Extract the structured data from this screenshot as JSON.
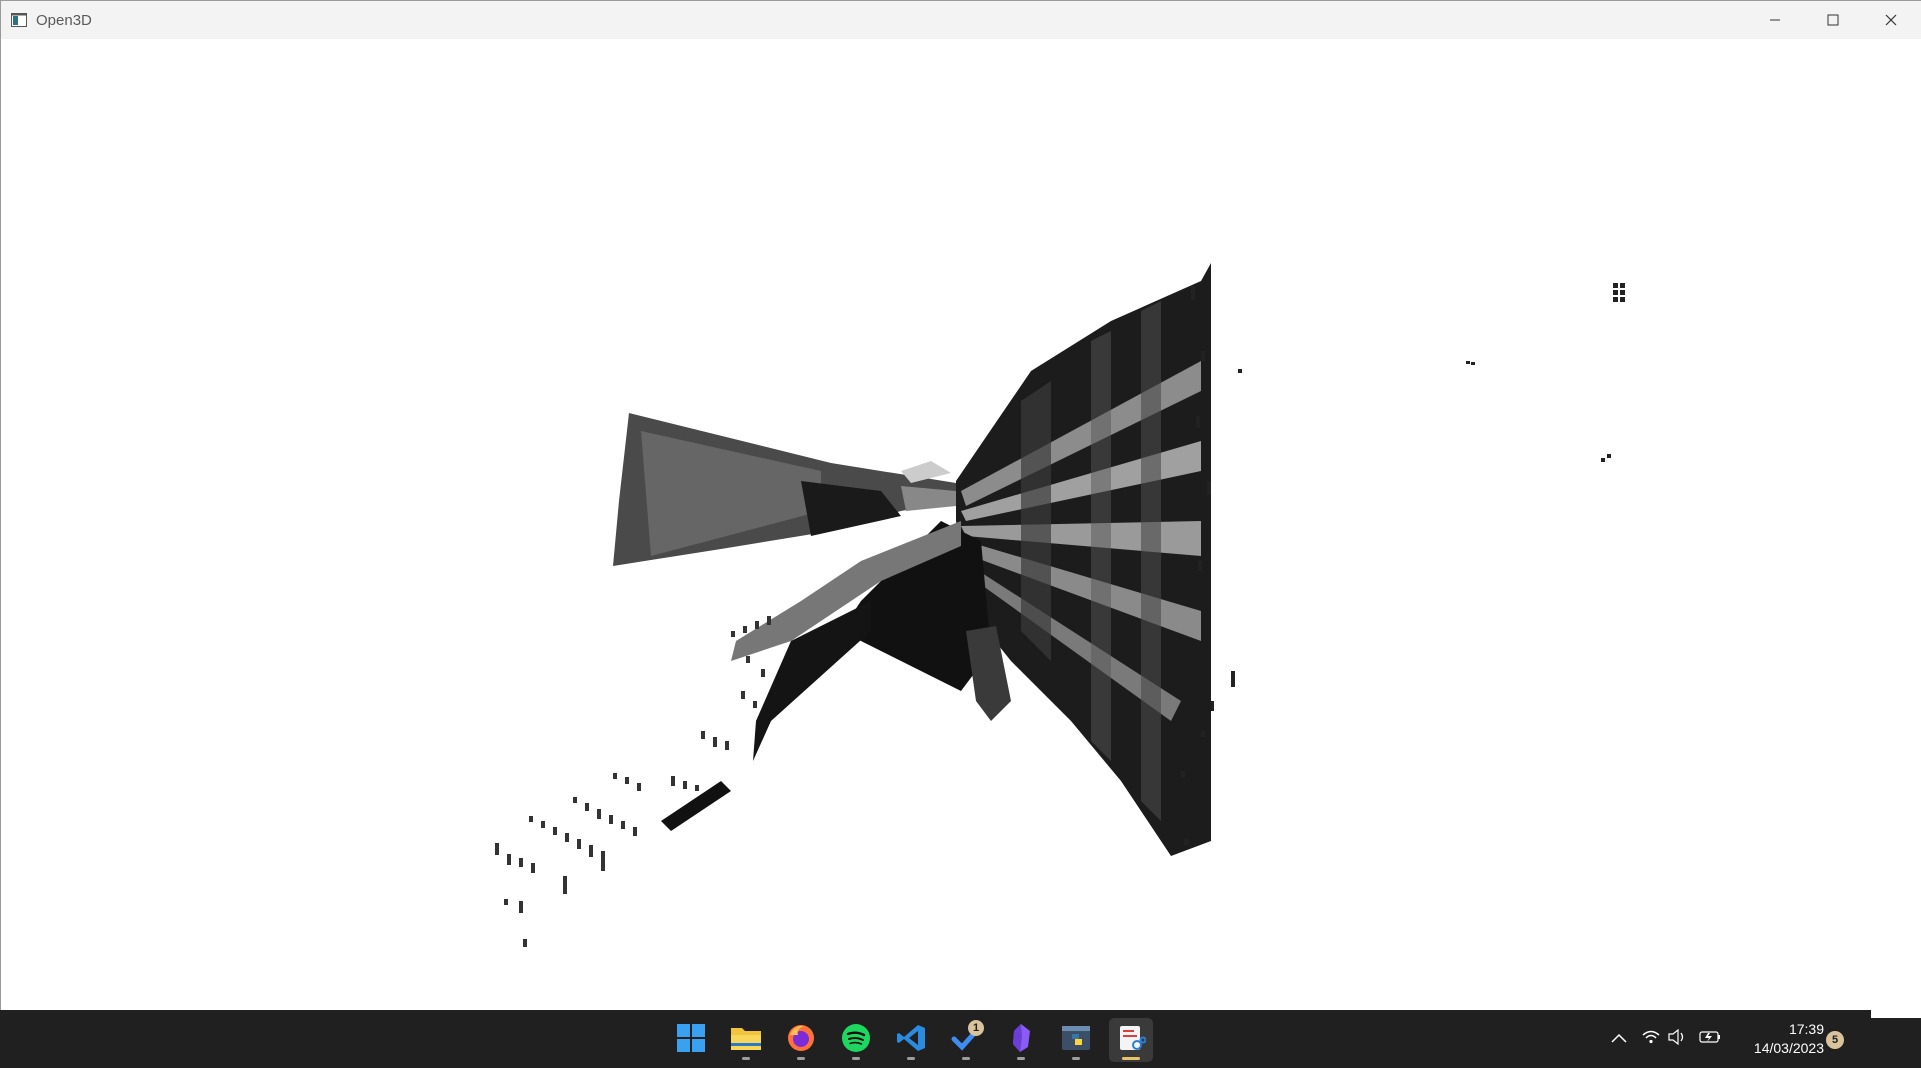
{
  "window": {
    "title": "Open3D",
    "controls": [
      "minimize-icon",
      "maximize-icon",
      "close-icon"
    ]
  },
  "viewport": {
    "content": "point-cloud-render",
    "background": "#ffffff",
    "point_color_dark": "#111111",
    "point_color_mid": "#6e6e6e"
  },
  "taskbar": {
    "background": "#202020",
    "apps": [
      {
        "name": "start-icon",
        "running": false
      },
      {
        "name": "file-explorer-icon",
        "running": true
      },
      {
        "name": "firefox-icon",
        "running": true
      },
      {
        "name": "spotify-icon",
        "running": true
      },
      {
        "name": "vscode-icon",
        "running": true
      },
      {
        "name": "todo-icon",
        "running": true,
        "badge": "1"
      },
      {
        "name": "obsidian-icon",
        "running": true
      },
      {
        "name": "python-icon",
        "running": true
      },
      {
        "name": "snipping-tool-icon",
        "running": true,
        "active": true
      }
    ],
    "tray": {
      "icons": [
        "chevron-up-icon",
        "wifi-icon",
        "volume-icon",
        "battery-icon"
      ],
      "time": "17:39",
      "date": "14/03/2023",
      "notification_count": "5"
    }
  }
}
